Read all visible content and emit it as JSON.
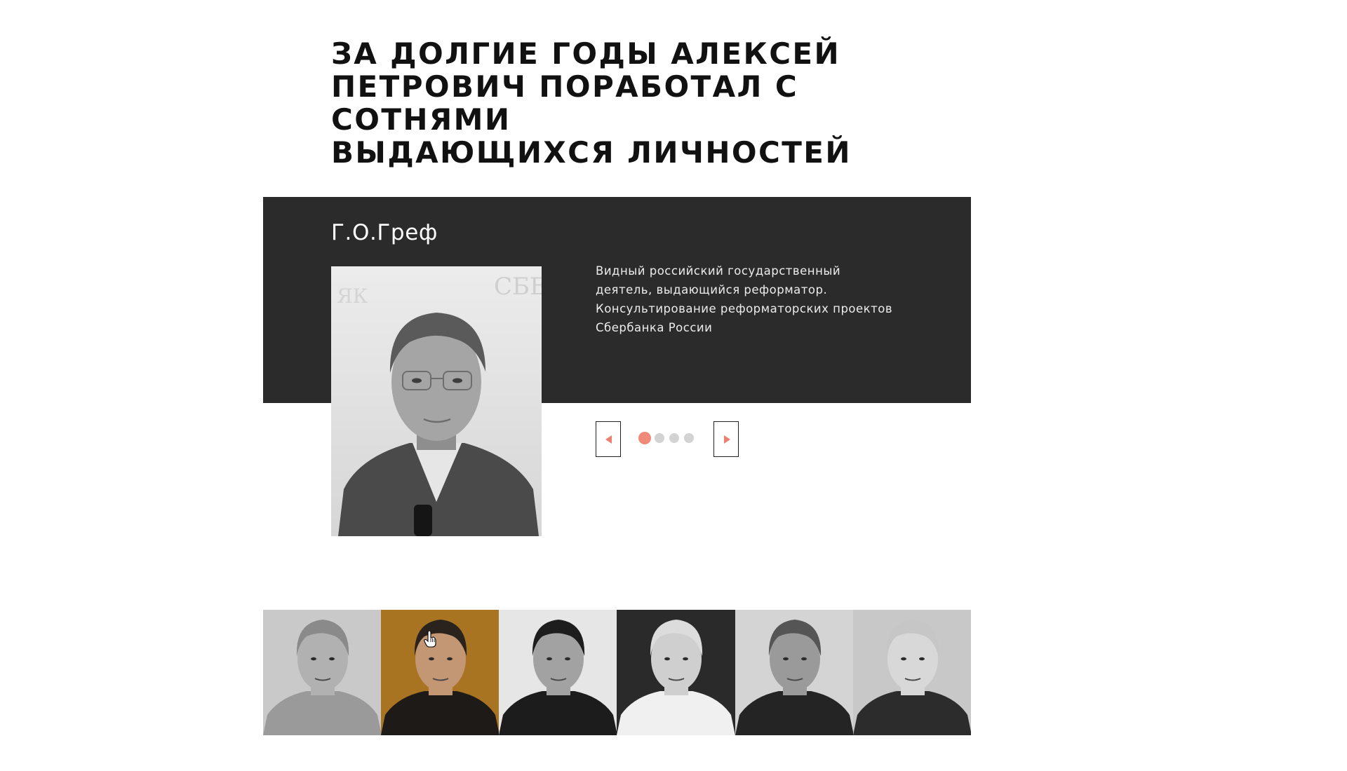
{
  "heading": {
    "lines": [
      "ЗА ДОЛГИЕ ГОДЫ АЛЕКСЕЙ",
      "ПЕТРОВИЧ ПОРАБОТАЛ С СОТНЯМИ",
      "ВЫДАЮЩИХСЯ ЛИЧНОСТЕЙ"
    ]
  },
  "slide": {
    "name": "Г.О.Греф",
    "description_lines": [
      "Видный российский государственный",
      "деятель, выдающийся реформатор.",
      "Консультирование реформаторских проектов",
      "Сбербанка России"
    ]
  },
  "carousel": {
    "slide_count": 4,
    "active_index": 0,
    "prev_icon": "triangle-left-icon",
    "next_icon": "triangle-right-icon"
  },
  "thumbnails": [
    {
      "name": "thumb-1",
      "mode": "faded grayscale",
      "bg": "#c9c9c9",
      "face": "#b1b1b1",
      "suit": "#9a9a9a",
      "hair": "#8a8a8a"
    },
    {
      "name": "thumb-2",
      "mode": "color (hovered)",
      "bg": "#a97422",
      "face": "#c49774",
      "suit": "#1e1a17",
      "hair": "#2a221c"
    },
    {
      "name": "thumb-3",
      "mode": "grayscale",
      "bg": "#e6e6e6",
      "face": "#a2a2a2",
      "suit": "#1c1c1c",
      "hair": "#1d1d1d"
    },
    {
      "name": "thumb-4",
      "mode": "grayscale",
      "bg": "#2a2a2a",
      "face": "#cfcfcf",
      "suit": "#f0f0f0",
      "hair": "#dcdcdc"
    },
    {
      "name": "thumb-5",
      "mode": "grayscale",
      "bg": "#d4d4d4",
      "face": "#9a9a9a",
      "suit": "#242424",
      "hair": "#555555"
    },
    {
      "name": "thumb-6",
      "mode": "grayscale",
      "bg": "#c8c8c8",
      "face": "#d8d8d8",
      "suit": "#2c2c2c",
      "hair": "#c6c6c6"
    }
  ],
  "colors": {
    "panel": "#2b2b2b",
    "accent": "#f08a78",
    "dot_inactive": "#d3d3d3",
    "heading": "#111111"
  }
}
